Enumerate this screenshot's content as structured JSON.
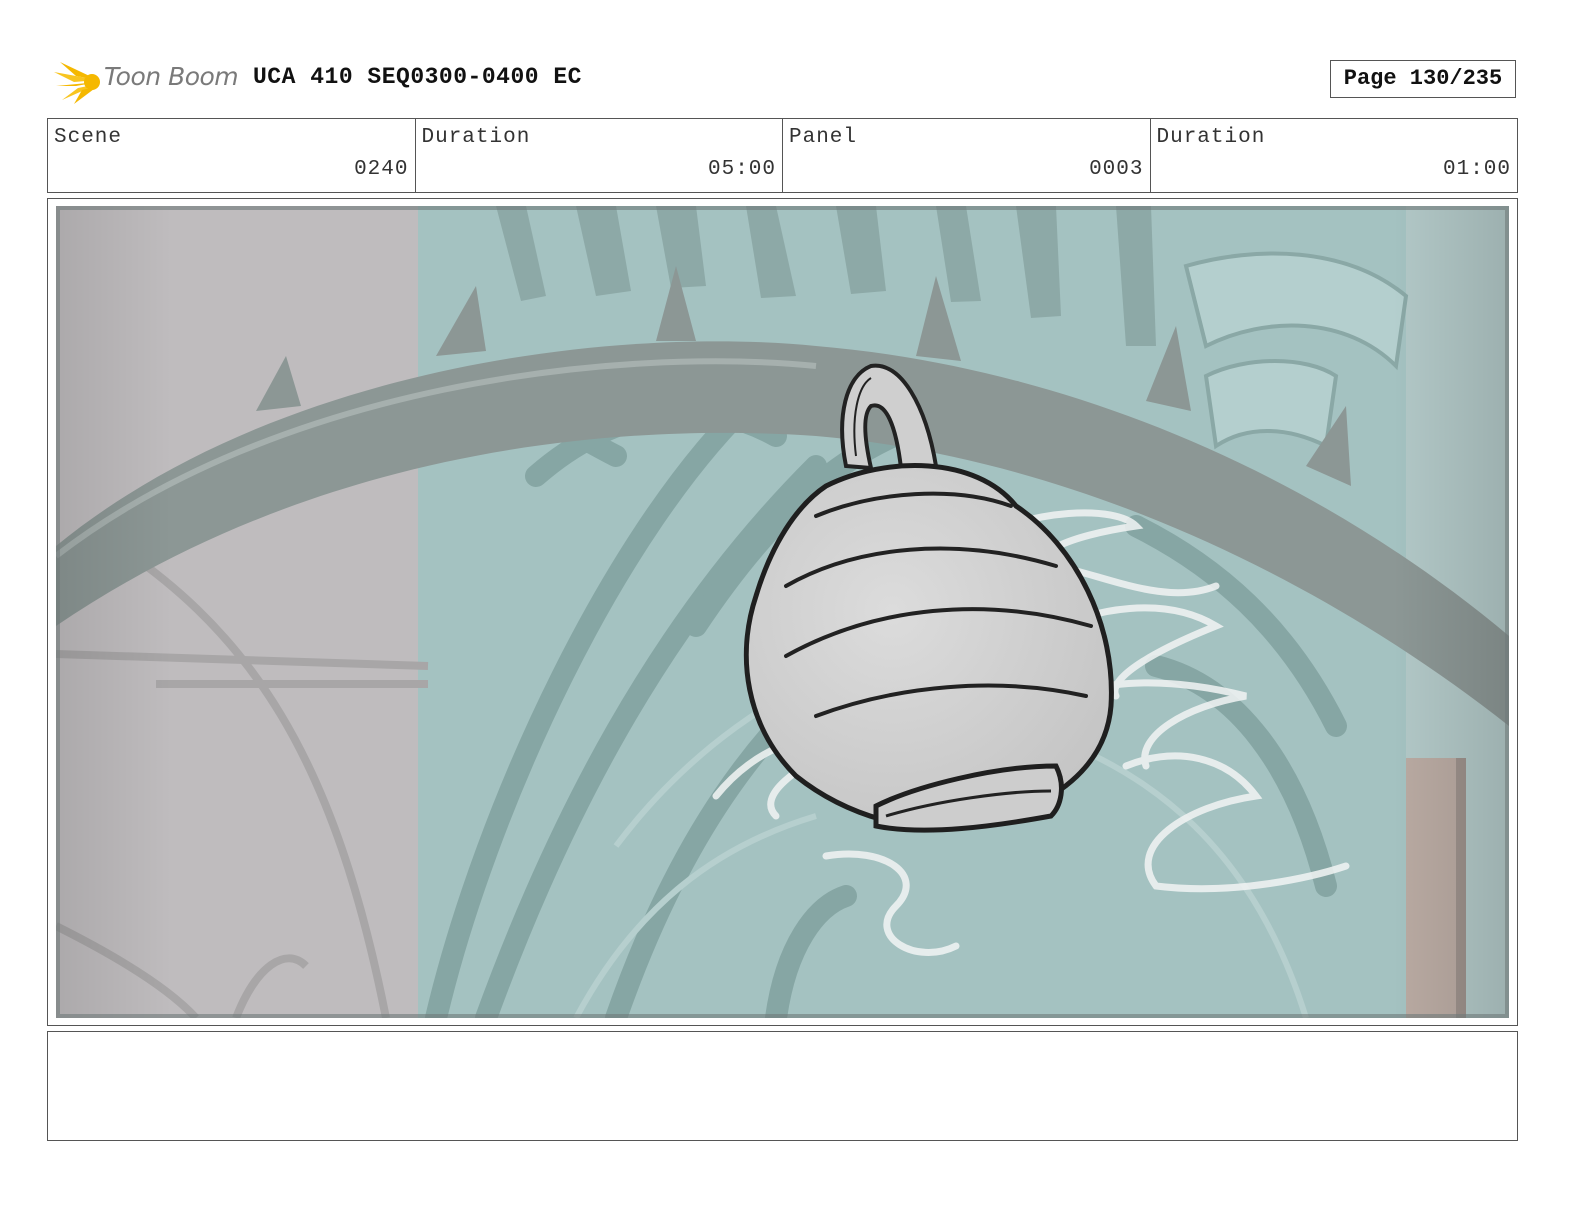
{
  "header": {
    "logo_text": "Toon Boom",
    "title": "UCA 410 SEQ0300-0400 EC",
    "page_label": "Page 130/235"
  },
  "info": {
    "scene_label": "Scene",
    "scene_value": "0240",
    "scene_duration_label": "Duration",
    "scene_duration_value": "05:00",
    "panel_label": "Panel",
    "panel_value": "0003",
    "panel_duration_label": "Duration",
    "panel_duration_value": "01:00"
  },
  "colors": {
    "logo_accent": "#f5b800",
    "logo_text": "#7a7a7a",
    "wall": "#bfbcbd",
    "gate_teal": "#9fc0bf",
    "gate_dark": "#7c9c9a",
    "arch": "#8a9594",
    "pot": "#d0d0d0",
    "sketch_line": "#222222"
  },
  "icons": {
    "logo": "toon-boom-sun-icon"
  }
}
